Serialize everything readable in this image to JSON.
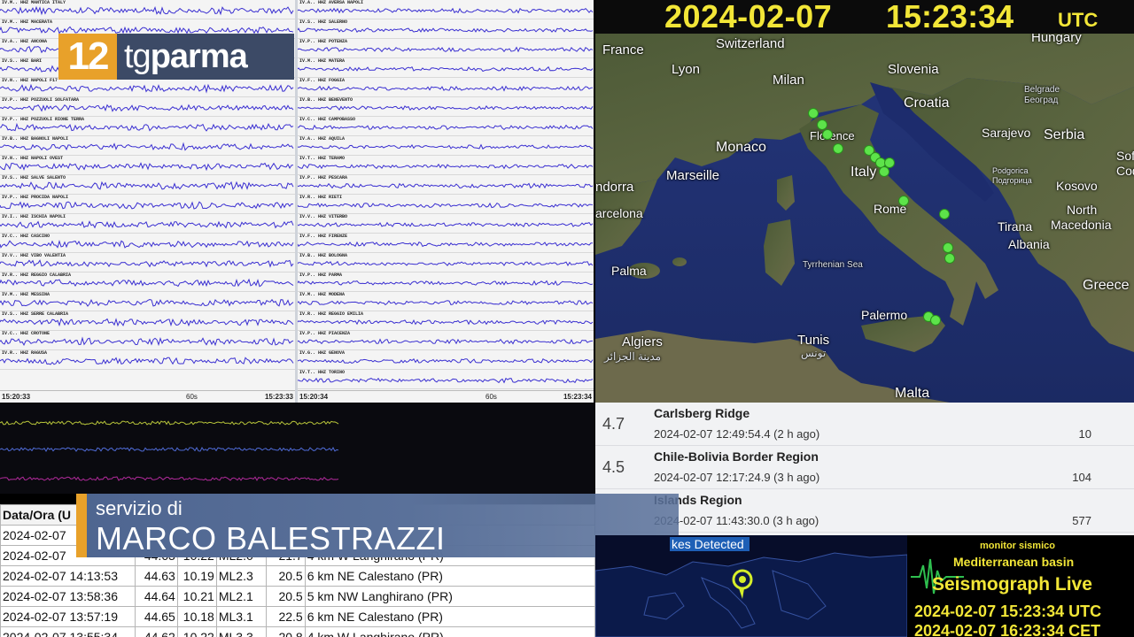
{
  "clock": {
    "date": "2024-02-07",
    "time": "15:23:34",
    "zone": "UTC"
  },
  "logo": {
    "number": "12",
    "brand_light": "tg",
    "brand_bold": "parma"
  },
  "seismograms": {
    "left_start": "15:20:33",
    "left_mid": "60s",
    "left_end": "15:23:33",
    "mid_start": "15:20:34",
    "mid_mid": "60s",
    "mid_end": "15:23:34",
    "trace_color": "#3a2fd1",
    "left_traces": [
      "IV.M.. HHZ MANTICA ITALY",
      "IV.M.. HHZ MACERATA",
      "IV.A.. HHZ ANCONA",
      "IV.S.. HHZ BARI",
      "IV.N.. HHZ NAPOLI F17",
      "IV.P.. HHZ POZZUOLI SOLFATARA",
      "IV.P.. HHZ POZZUOLI RIONE TERRA",
      "IV.B.. HHZ BAGNOLI NAPOLI",
      "IV.N.. HHZ NAPOLI OVEST",
      "IV.S.. HHZ SALVE SALENTO",
      "IV.P.. HHZ PROCIDA NAPOLI",
      "IV.I.. HHZ ISCHIA NAPOLI",
      "IV.C.. HHZ CASCINO",
      "IV.V.. HHZ VIBO VALENTIA",
      "IV.R.. HHZ REGGIO CALABRIA",
      "IV.M.. HHZ MESSINA",
      "IV.S.. HHZ SERRE CALABRIA",
      "IV.C.. HHZ CROTONE",
      "IV.R.. HHZ RAGUSA"
    ],
    "mid_traces": [
      "IV.A.. HHZ AVERSA NAPOLI",
      "IV.S.. HHZ SALERNO",
      "IV.P.. HHZ POTENZA",
      "IV.M.. HHZ MATERA",
      "IV.F.. HHZ FOGGIA",
      "IV.B.. HHZ BENEVENTO",
      "IV.C.. HHZ CAMPOBASSO",
      "IV.A.. HHZ AQUILA",
      "IV.T.. HHZ TERAMO",
      "IV.P.. HHZ PESCARA",
      "IV.R.. HHZ RIETI",
      "IV.V.. HHZ VITERBO",
      "IV.F.. HHZ FIRENZE",
      "IV.B.. HHZ BOLOGNA",
      "IV.P.. HHZ PARMA",
      "IV.M.. HHZ MODENA",
      "IV.R.. HHZ REGGIO EMILIA",
      "IV.P.. HHZ PIACENZA",
      "IV.G.. HHZ GENOVA",
      "IV.T.. HHZ TORINO"
    ]
  },
  "map": {
    "labels": {
      "france": "France",
      "switzerland": "Switzerland",
      "hungary": "Hungary",
      "lyon": "Lyon",
      "milan": "Milan",
      "slovenia": "Slovenia",
      "croatia": "Croatia",
      "monaco": "Monaco",
      "florence": "Florence",
      "marseille": "Marseille",
      "italy": "Italy",
      "belgrade": "Belgrade",
      "belgrade_cyr": "Београд",
      "sarajevo": "Sarajevo",
      "serbia": "Serbia",
      "andorra": "ndorra",
      "barcelona": "arcelona",
      "rome": "Rome",
      "podgorica": "Podgorica",
      "podgorica_cyr": "Подгорица",
      "kosovo": "Kosovo",
      "north_macedonia_1": "North",
      "north_macedonia_2": "Macedonia",
      "tirana": "Tirana",
      "albania": "Albania",
      "palma": "Palma",
      "tyrrhenian": "Tyrrhenian Sea",
      "greece": "Greece",
      "palermo": "Palermo",
      "algiers": "Algiers",
      "algiers_ar": "مدينة الجزائر",
      "tunis": "Tunis",
      "tunis_ar": "تونس",
      "malta": "Malta",
      "sofia": "Sof",
      "sofia_cyr": "Соф"
    }
  },
  "events": [
    {
      "mag": "4.7",
      "region": "Carlsberg Ridge",
      "time": "2024-02-07 12:49:54.4 (2 h ago)",
      "depth": "10"
    },
    {
      "mag": "4.5",
      "region": "Chile-Bolivia Border Region",
      "time": "2024-02-07 12:17:24.9 (3 h ago)",
      "depth": "104"
    },
    {
      "mag": "",
      "region": "Islands Region",
      "time": "2024-02-07 11:43:30.0 (3 h ago)",
      "depth": "577"
    }
  ],
  "quakes_table": {
    "header": "Data/Ora (U",
    "rows": [
      {
        "dt": "2024-02-07",
        "lat": "",
        "lon": "",
        "mag": "",
        "dep": "",
        "loc": ""
      },
      {
        "dt": "2024-02-07",
        "lat": "44.63",
        "lon": "10.22",
        "mag": "ML2.0",
        "dep": "21.7",
        "loc": "4 km W Langhirano (PR)"
      },
      {
        "dt": "2024-02-07 14:13:53",
        "lat": "44.63",
        "lon": "10.19",
        "mag": "ML2.3",
        "dep": "20.5",
        "loc": "6 km NE Calestano (PR)"
      },
      {
        "dt": "2024-02-07 13:58:36",
        "lat": "44.64",
        "lon": "10.21",
        "mag": "ML2.1",
        "dep": "20.5",
        "loc": "5 km NW Langhirano (PR)"
      },
      {
        "dt": "2024-02-07 13:57:19",
        "lat": "44.65",
        "lon": "10.18",
        "mag": "ML3.1",
        "dep": "22.5",
        "loc": "6 km NE Calestano (PR)"
      },
      {
        "dt": "2024-02-07 13:55:34",
        "lat": "44.62",
        "lon": "10.22",
        "mag": "ML3.3",
        "dep": "20.8",
        "loc": "4 km W Langhirano (PR)"
      }
    ]
  },
  "lower_third": {
    "role": "servizio di",
    "name": "MARCO BALESTRAZZI"
  },
  "minimap": {
    "tag": "kes Detected"
  },
  "live": {
    "monitor": "monitor sismico",
    "basin": "Mediterranean basin",
    "title": "Seismograph Live",
    "utc_row": "2024-02-07   15:23:34  UTC",
    "cet_row": "2024-02-07   16:23:34  CET"
  },
  "colors": {
    "accent_orange": "#e8a12a",
    "clock_yellow": "#f2e637",
    "map_sea": "#1f2f6b",
    "quake_green": "#5de34a"
  }
}
